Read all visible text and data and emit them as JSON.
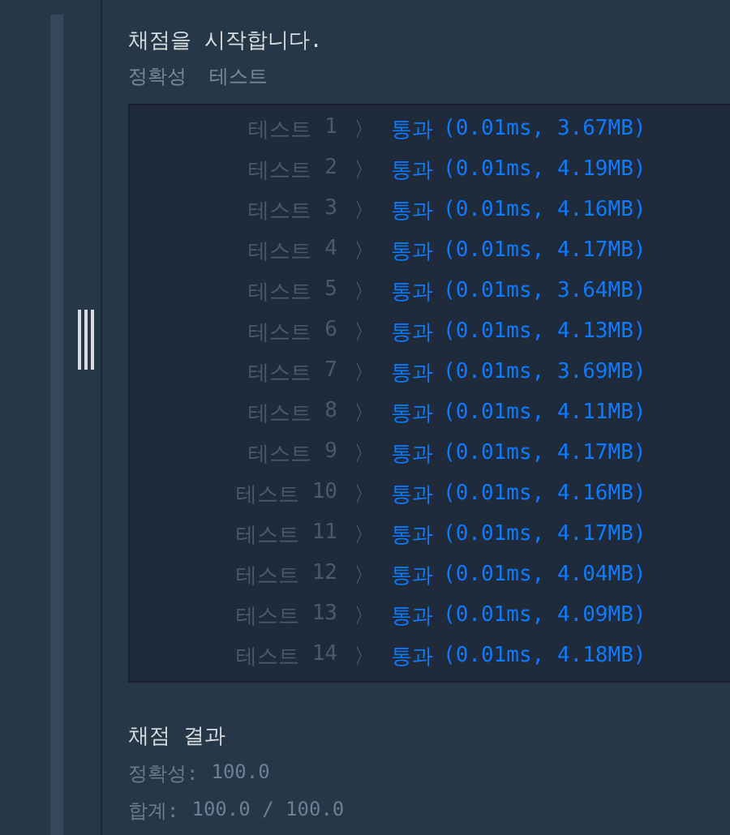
{
  "message": "채점을 시작합니다.",
  "section_title": [
    "정확성",
    "테스트"
  ],
  "tests": [
    {
      "label": "테스트",
      "number": "1",
      "chevron": "〉",
      "status": "통과",
      "detail": "(0.01ms, 3.67MB)"
    },
    {
      "label": "테스트",
      "number": "2",
      "chevron": "〉",
      "status": "통과",
      "detail": "(0.01ms, 4.19MB)"
    },
    {
      "label": "테스트",
      "number": "3",
      "chevron": "〉",
      "status": "통과",
      "detail": "(0.01ms, 4.16MB)"
    },
    {
      "label": "테스트",
      "number": "4",
      "chevron": "〉",
      "status": "통과",
      "detail": "(0.01ms, 4.17MB)"
    },
    {
      "label": "테스트",
      "number": "5",
      "chevron": "〉",
      "status": "통과",
      "detail": "(0.01ms, 3.64MB)"
    },
    {
      "label": "테스트",
      "number": "6",
      "chevron": "〉",
      "status": "통과",
      "detail": "(0.01ms, 4.13MB)"
    },
    {
      "label": "테스트",
      "number": "7",
      "chevron": "〉",
      "status": "통과",
      "detail": "(0.01ms, 3.69MB)"
    },
    {
      "label": "테스트",
      "number": "8",
      "chevron": "〉",
      "status": "통과",
      "detail": "(0.01ms, 4.11MB)"
    },
    {
      "label": "테스트",
      "number": "9",
      "chevron": "〉",
      "status": "통과",
      "detail": "(0.01ms, 4.17MB)"
    },
    {
      "label": "테스트",
      "number": "10",
      "chevron": "〉",
      "status": "통과",
      "detail": "(0.01ms, 4.16MB)"
    },
    {
      "label": "테스트",
      "number": "11",
      "chevron": "〉",
      "status": "통과",
      "detail": "(0.01ms, 4.17MB)"
    },
    {
      "label": "테스트",
      "number": "12",
      "chevron": "〉",
      "status": "통과",
      "detail": "(0.01ms, 4.04MB)"
    },
    {
      "label": "테스트",
      "number": "13",
      "chevron": "〉",
      "status": "통과",
      "detail": "(0.01ms, 4.09MB)"
    },
    {
      "label": "테스트",
      "number": "14",
      "chevron": "〉",
      "status": "통과",
      "detail": "(0.01ms, 4.18MB)"
    }
  ],
  "summary": {
    "title": "채점 결과",
    "lines": [
      {
        "label": "정확성:",
        "value": "100.0"
      },
      {
        "label": "합계:",
        "value": "100.0 / 100.0"
      }
    ]
  }
}
